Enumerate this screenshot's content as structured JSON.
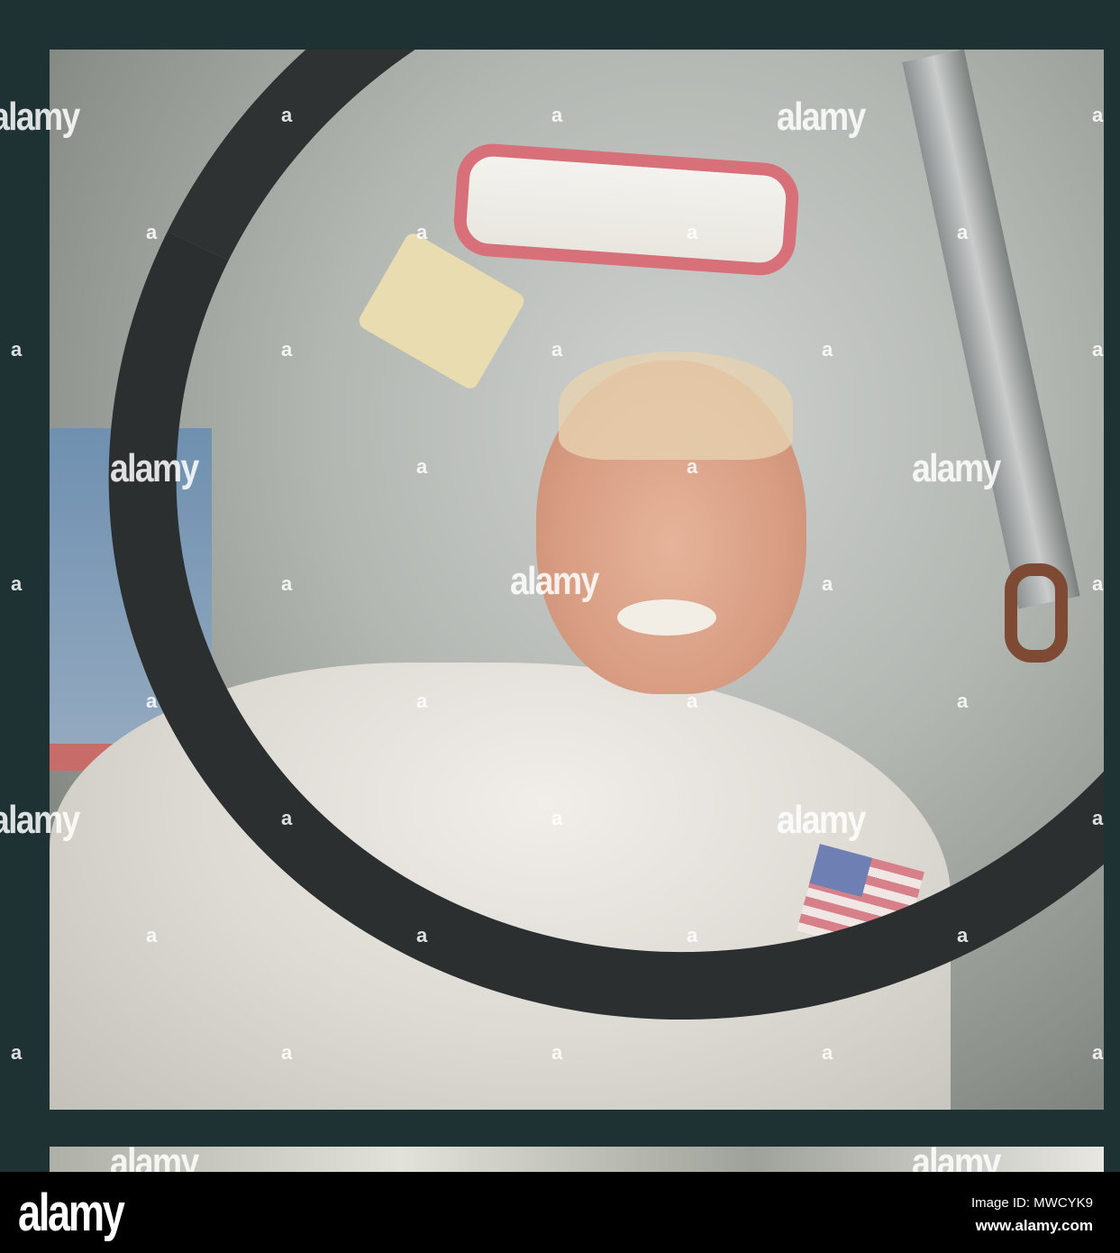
{
  "watermark": {
    "brand": "alamy",
    "small_mark": "a"
  },
  "footer": {
    "logo": "alamy",
    "image_id": "Image ID: MWCYK9",
    "website": "www.alamy.com"
  }
}
